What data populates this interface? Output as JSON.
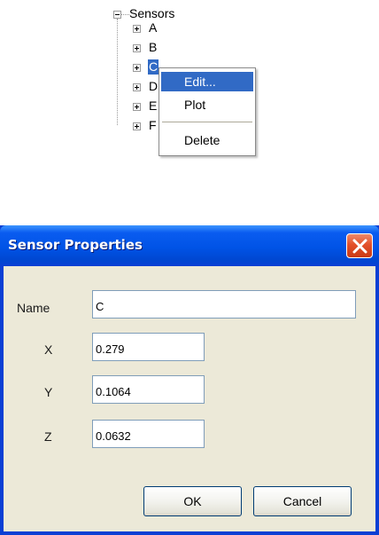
{
  "tree": {
    "root_label": "Sensors",
    "children": [
      "A",
      "B",
      "C",
      "D",
      "E",
      "F"
    ],
    "selected_child": "C"
  },
  "context_menu": {
    "items": [
      "Edit...",
      "Plot",
      "Delete"
    ],
    "highlighted": "Edit..."
  },
  "dialog": {
    "title": "Sensor Properties",
    "fields": {
      "name": {
        "label": "Name",
        "value": "C"
      },
      "x": {
        "label": "X",
        "value": "0.279"
      },
      "y": {
        "label": "Y",
        "value": "0.1064"
      },
      "z": {
        "label": "Z",
        "value": "0.0632"
      }
    },
    "ok_label": "OK",
    "cancel_label": "Cancel"
  },
  "colors": {
    "selection": "#316ac5",
    "titlebar": "#0053e6",
    "close_button": "#e3502a",
    "dialog_face": "#ece9d8"
  },
  "icons": [
    "expand-minus-icon",
    "expand-plus-icon",
    "close-x-icon"
  ]
}
